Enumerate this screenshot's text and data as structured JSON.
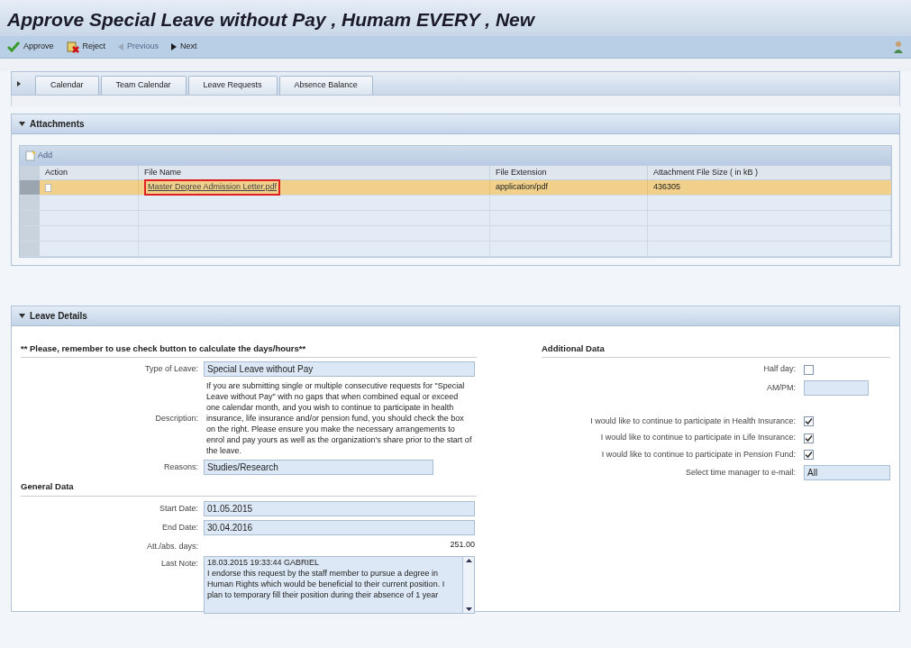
{
  "window": {
    "title": "Approve Special Leave without Pay , Humam EVERY , New"
  },
  "toolbar": [
    {
      "label": "Approve",
      "kind": "approve",
      "disabled": false
    },
    {
      "label": "Reject",
      "kind": "reject",
      "disabled": false
    },
    {
      "label": "Previous",
      "kind": "previous",
      "disabled": true
    },
    {
      "label": "Next",
      "kind": "next",
      "disabled": false
    }
  ],
  "tabs": [
    {
      "label": "Calendar",
      "selected": false
    },
    {
      "label": "Team Calendar",
      "selected": false
    },
    {
      "label": "Leave Requests",
      "selected": false
    },
    {
      "label": "Absence Balance",
      "selected": false
    }
  ],
  "attachments": {
    "title": "Attachments",
    "add_button": {
      "label": "Add",
      "disabled": true
    },
    "columns": [
      "Action",
      "File Name",
      "File Extension",
      "Attachment File Size ( in kB )"
    ],
    "rows": [
      {
        "file_name": "Master Degree Admission Letter.pdf",
        "file_extension": "application/pdf",
        "size": "436305",
        "selected": true
      }
    ]
  },
  "leave_details": {
    "title": "Leave Details",
    "reminder": "** Please, remember to use check button to calculate the days/hours**",
    "fields": [
      {
        "label": "Type of Leave:",
        "value": "Special Leave without Pay",
        "kind": "field"
      },
      {
        "label": "Description:",
        "value": "If you are submitting single or multiple consecutive requests for \"Special Leave without Pay\" with no gaps that when combined equal or exceed one calendar month, and you wish to continue to participate in health insurance, life insurance and/or pension fund, you should check the box on the right. Please ensure you make the necessary arrangements to enrol and pay yours as well as the organization's share prior to the start of the leave.",
        "kind": "text"
      },
      {
        "label": "Reasons:",
        "value": "Studies/Research",
        "kind": "field"
      }
    ],
    "general_title": "General Data",
    "general_fields": [
      {
        "label": "Start Date:",
        "value": "01.05.2015",
        "kind": "field"
      },
      {
        "label": "End Date:",
        "value": "30.04.2016",
        "kind": "field"
      },
      {
        "label": "Att./abs. days:",
        "value": "251.00",
        "kind": "number"
      },
      {
        "label": "Last Note:",
        "value": "18.03.2015 19:33:44 GABRIEL\nI endorse this request by the staff member to pursue a degree in Human Rights which would be beneficial to their current position. I plan to temporary fill their position during their absence of 1 year",
        "kind": "note"
      }
    ],
    "additional_title": "Additional Data",
    "additional": [
      {
        "label": "Half day:",
        "kind": "checkbox",
        "checked": false
      },
      {
        "label": "AM/PM:",
        "kind": "field"
      },
      {
        "kind": "spacer"
      },
      {
        "label": "I would like to continue to participate in Health Insurance:",
        "kind": "checkbox",
        "checked": true
      },
      {
        "label": "I would like to continue to participate in Life Insurance:",
        "kind": "checkbox",
        "checked": true
      },
      {
        "label": "I would like to continue to participate in Pension Fund:",
        "kind": "checkbox",
        "checked": true
      },
      {
        "label": "Select time manager to e-mail:",
        "kind": "field",
        "value": "All"
      }
    ]
  }
}
